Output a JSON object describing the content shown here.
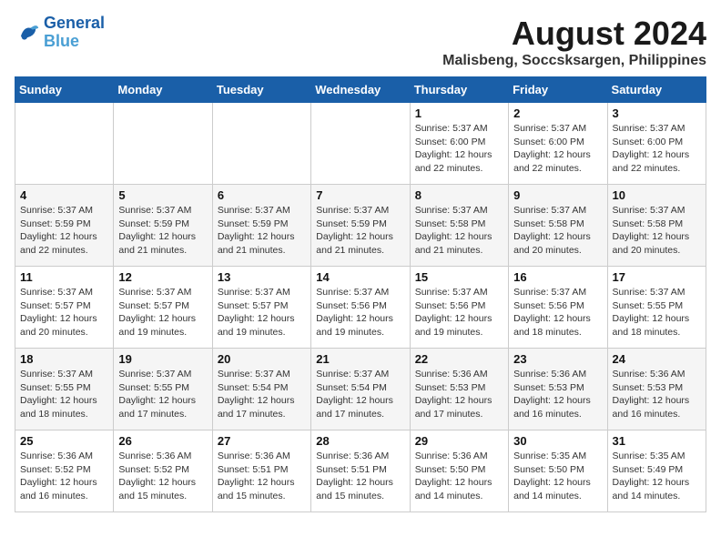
{
  "header": {
    "logo_line1": "General",
    "logo_line2": "Blue",
    "month_year": "August 2024",
    "location": "Malisbeng, Soccsksargen, Philippines"
  },
  "days_of_week": [
    "Sunday",
    "Monday",
    "Tuesday",
    "Wednesday",
    "Thursday",
    "Friday",
    "Saturday"
  ],
  "weeks": [
    [
      {
        "day": "",
        "info": ""
      },
      {
        "day": "",
        "info": ""
      },
      {
        "day": "",
        "info": ""
      },
      {
        "day": "",
        "info": ""
      },
      {
        "day": "1",
        "info": "Sunrise: 5:37 AM\nSunset: 6:00 PM\nDaylight: 12 hours\nand 22 minutes."
      },
      {
        "day": "2",
        "info": "Sunrise: 5:37 AM\nSunset: 6:00 PM\nDaylight: 12 hours\nand 22 minutes."
      },
      {
        "day": "3",
        "info": "Sunrise: 5:37 AM\nSunset: 6:00 PM\nDaylight: 12 hours\nand 22 minutes."
      }
    ],
    [
      {
        "day": "4",
        "info": "Sunrise: 5:37 AM\nSunset: 5:59 PM\nDaylight: 12 hours\nand 22 minutes."
      },
      {
        "day": "5",
        "info": "Sunrise: 5:37 AM\nSunset: 5:59 PM\nDaylight: 12 hours\nand 21 minutes."
      },
      {
        "day": "6",
        "info": "Sunrise: 5:37 AM\nSunset: 5:59 PM\nDaylight: 12 hours\nand 21 minutes."
      },
      {
        "day": "7",
        "info": "Sunrise: 5:37 AM\nSunset: 5:59 PM\nDaylight: 12 hours\nand 21 minutes."
      },
      {
        "day": "8",
        "info": "Sunrise: 5:37 AM\nSunset: 5:58 PM\nDaylight: 12 hours\nand 21 minutes."
      },
      {
        "day": "9",
        "info": "Sunrise: 5:37 AM\nSunset: 5:58 PM\nDaylight: 12 hours\nand 20 minutes."
      },
      {
        "day": "10",
        "info": "Sunrise: 5:37 AM\nSunset: 5:58 PM\nDaylight: 12 hours\nand 20 minutes."
      }
    ],
    [
      {
        "day": "11",
        "info": "Sunrise: 5:37 AM\nSunset: 5:57 PM\nDaylight: 12 hours\nand 20 minutes."
      },
      {
        "day": "12",
        "info": "Sunrise: 5:37 AM\nSunset: 5:57 PM\nDaylight: 12 hours\nand 19 minutes."
      },
      {
        "day": "13",
        "info": "Sunrise: 5:37 AM\nSunset: 5:57 PM\nDaylight: 12 hours\nand 19 minutes."
      },
      {
        "day": "14",
        "info": "Sunrise: 5:37 AM\nSunset: 5:56 PM\nDaylight: 12 hours\nand 19 minutes."
      },
      {
        "day": "15",
        "info": "Sunrise: 5:37 AM\nSunset: 5:56 PM\nDaylight: 12 hours\nand 19 minutes."
      },
      {
        "day": "16",
        "info": "Sunrise: 5:37 AM\nSunset: 5:56 PM\nDaylight: 12 hours\nand 18 minutes."
      },
      {
        "day": "17",
        "info": "Sunrise: 5:37 AM\nSunset: 5:55 PM\nDaylight: 12 hours\nand 18 minutes."
      }
    ],
    [
      {
        "day": "18",
        "info": "Sunrise: 5:37 AM\nSunset: 5:55 PM\nDaylight: 12 hours\nand 18 minutes."
      },
      {
        "day": "19",
        "info": "Sunrise: 5:37 AM\nSunset: 5:55 PM\nDaylight: 12 hours\nand 17 minutes."
      },
      {
        "day": "20",
        "info": "Sunrise: 5:37 AM\nSunset: 5:54 PM\nDaylight: 12 hours\nand 17 minutes."
      },
      {
        "day": "21",
        "info": "Sunrise: 5:37 AM\nSunset: 5:54 PM\nDaylight: 12 hours\nand 17 minutes."
      },
      {
        "day": "22",
        "info": "Sunrise: 5:36 AM\nSunset: 5:53 PM\nDaylight: 12 hours\nand 17 minutes."
      },
      {
        "day": "23",
        "info": "Sunrise: 5:36 AM\nSunset: 5:53 PM\nDaylight: 12 hours\nand 16 minutes."
      },
      {
        "day": "24",
        "info": "Sunrise: 5:36 AM\nSunset: 5:53 PM\nDaylight: 12 hours\nand 16 minutes."
      }
    ],
    [
      {
        "day": "25",
        "info": "Sunrise: 5:36 AM\nSunset: 5:52 PM\nDaylight: 12 hours\nand 16 minutes."
      },
      {
        "day": "26",
        "info": "Sunrise: 5:36 AM\nSunset: 5:52 PM\nDaylight: 12 hours\nand 15 minutes."
      },
      {
        "day": "27",
        "info": "Sunrise: 5:36 AM\nSunset: 5:51 PM\nDaylight: 12 hours\nand 15 minutes."
      },
      {
        "day": "28",
        "info": "Sunrise: 5:36 AM\nSunset: 5:51 PM\nDaylight: 12 hours\nand 15 minutes."
      },
      {
        "day": "29",
        "info": "Sunrise: 5:36 AM\nSunset: 5:50 PM\nDaylight: 12 hours\nand 14 minutes."
      },
      {
        "day": "30",
        "info": "Sunrise: 5:35 AM\nSunset: 5:50 PM\nDaylight: 12 hours\nand 14 minutes."
      },
      {
        "day": "31",
        "info": "Sunrise: 5:35 AM\nSunset: 5:49 PM\nDaylight: 12 hours\nand 14 minutes."
      }
    ]
  ]
}
